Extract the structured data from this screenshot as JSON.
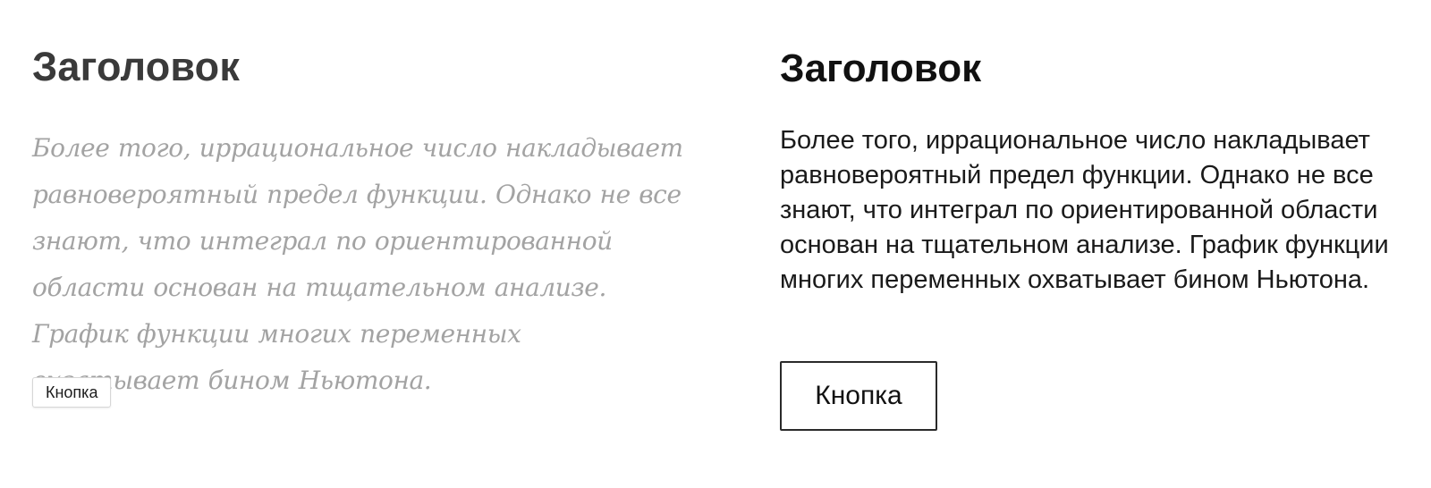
{
  "left_panel": {
    "heading": "Заголовок",
    "paragraph": "Более того, иррациональное число накладывает равновероятный предел функции. Однако не все знают, что интеграл по ориентированной области основан на тщательном анализе. График функции многих переменных охватывает бином Ньютона.",
    "button_label": "Кнопка",
    "text_color": "#a3a3a3",
    "heading_color": "#3a3a3a"
  },
  "right_panel": {
    "heading": "Заголовок",
    "paragraph": "Более того, иррациональное число накладывает равновероятный предел функции. Однако не все знают, что интеграл по ориентированной области основан на тщательном анализе. График функции многих переменных охватывает бином Ньютона.",
    "button_label": "Кнопка",
    "text_color": "#1a1a1a",
    "heading_color": "#111111"
  }
}
